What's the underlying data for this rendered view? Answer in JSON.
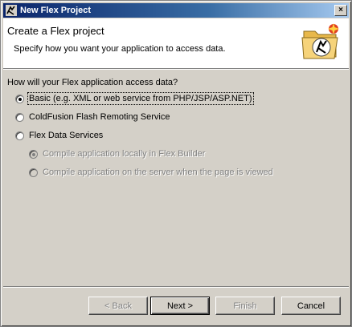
{
  "window": {
    "title": "New Flex Project",
    "close_label": "×"
  },
  "banner": {
    "heading": "Create a Flex project",
    "subtitle": "Specify how you want your application to access data."
  },
  "form": {
    "question": "How will your Flex application access data?",
    "options": [
      {
        "label": "Basic (e.g. XML or web service from PHP/JSP/ASP.NET)",
        "checked": true,
        "enabled": true
      },
      {
        "label": "ColdFusion Flash Remoting Service",
        "checked": false,
        "enabled": true
      },
      {
        "label": "Flex Data Services",
        "checked": false,
        "enabled": true
      }
    ],
    "sub_options": [
      {
        "label": "Compile application locally in Flex Builder",
        "checked": true,
        "enabled": false
      },
      {
        "label": "Compile application on the server when the page is viewed",
        "checked": false,
        "enabled": false
      }
    ]
  },
  "buttons": {
    "back": "< Back",
    "next": "Next >",
    "finish": "Finish",
    "cancel": "Cancel"
  },
  "icons": {
    "app": "flex-logo-icon",
    "banner": "flex-folder-icon"
  }
}
